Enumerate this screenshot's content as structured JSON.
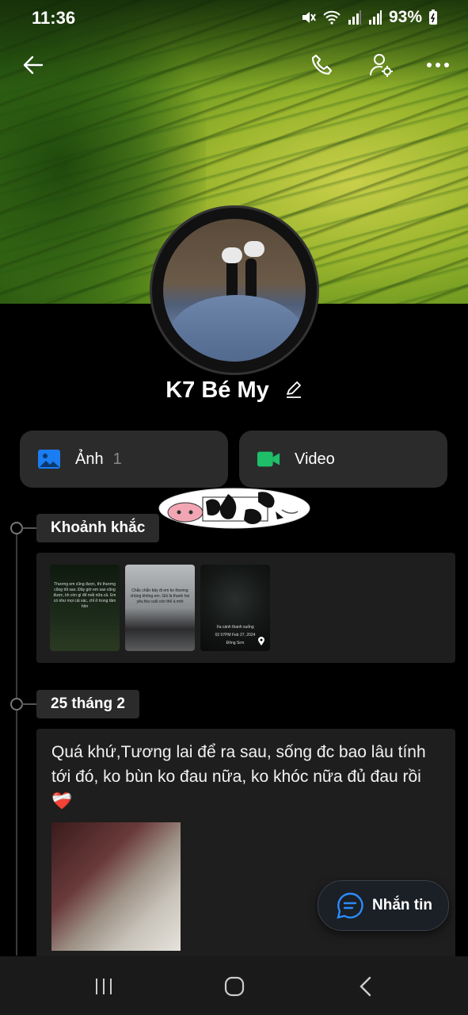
{
  "status_bar": {
    "time": "11:36",
    "battery": "93%",
    "icons": [
      "mute-icon",
      "wifi-icon",
      "signal-icon",
      "signal-icon",
      "battery-icon"
    ]
  },
  "top_bar": {
    "icons": [
      "back-arrow-icon",
      "phone-icon",
      "profile-settings-icon",
      "more-icon"
    ]
  },
  "profile": {
    "name": "K7 Bé My"
  },
  "media_tiles": {
    "photos_label": "Ảnh",
    "photos_count": "1",
    "video_label": "Video",
    "photos_color": "#1a7df2",
    "video_color": "#1fbf6a"
  },
  "timeline": {
    "moments_label": "Khoảnh khắc",
    "date_label": "25 tháng 2"
  },
  "moments": [
    {
      "caption": "Thương em cũng được, thì thương cũng tốt sao. Đây giờ em sao cũng được, kh còn gì để mất nữa cả. Em có như mọi cái xác, chỉ ở trong tâm hồn"
    },
    {
      "caption": "Chắc chắn bây đi em ko thương chúng không em. Gió là thanh hoi yêu tha cuối còn thế à mới"
    },
    {
      "caption": "Xa cánh thanh xuống",
      "date": "02 07PM Feb 27, 2024",
      "location": "Đông Sơn"
    }
  ],
  "post": {
    "text": "Quá khứ,Tương lai để ra sau, sống đc bao lâu tính tới đó, ko bùn ko đau nữa, ko khóc nữa đủ đau rồi❤️‍🩹"
  },
  "message_button": {
    "label": "Nhắn tin"
  },
  "nav_bar": {
    "icons": [
      "recent-apps-icon",
      "home-icon",
      "back-icon"
    ]
  }
}
